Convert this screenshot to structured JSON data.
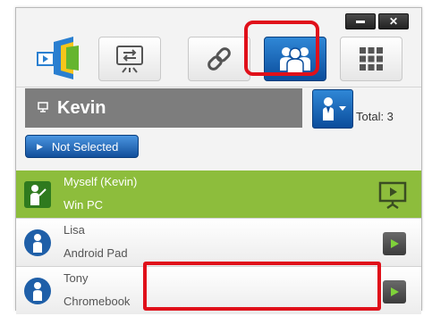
{
  "window": {
    "minimize_icon": "minimize-icon",
    "close_icon": "close-icon",
    "close_label": "✕"
  },
  "toolbar": {
    "logo_icon": "app-logo-icon",
    "tools": [
      {
        "name": "display-control",
        "icon": "display-switch-icon"
      },
      {
        "name": "link",
        "icon": "link-icon"
      },
      {
        "name": "users",
        "icon": "users-group-icon",
        "selected": true
      },
      {
        "name": "apps",
        "icon": "grid-icon"
      }
    ]
  },
  "header": {
    "user_name": "Kevin",
    "total_label": "Total: 3",
    "select_label": "Not Selected"
  },
  "participants": [
    {
      "name": "Myself (Kevin)",
      "device": "Win PC",
      "role": "presenter",
      "action_icon": "present-screen-icon"
    },
    {
      "name": "Lisa",
      "device": "Android Pad",
      "role": "attendee",
      "action_icon": "play-icon"
    },
    {
      "name": "Tony",
      "device": "Chromebook",
      "role": "attendee",
      "action_icon": "play-icon"
    }
  ],
  "colors": {
    "accent_blue": "#0b4d9c",
    "self_row_green": "#8dbd3c",
    "highlight_red": "#e0101a",
    "name_bar_gray": "#7d7d7d"
  }
}
